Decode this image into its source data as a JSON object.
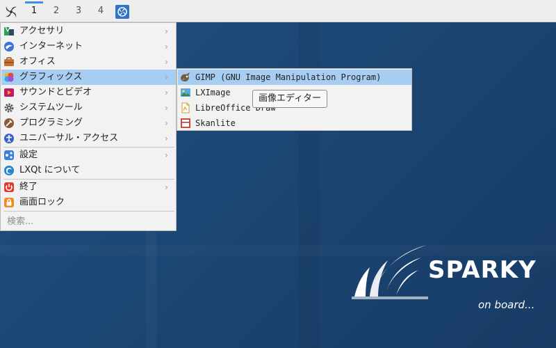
{
  "panel": {
    "desktops": [
      "1",
      "2",
      "3",
      "4"
    ],
    "active_desktop": "1"
  },
  "main_menu": {
    "items": [
      {
        "label": "アクセサリ",
        "icon": "accessories-icon",
        "submenu": true
      },
      {
        "label": "インターネット",
        "icon": "internet-icon",
        "submenu": true
      },
      {
        "label": "オフィス",
        "icon": "office-icon",
        "submenu": true
      },
      {
        "label": "グラフィックス",
        "icon": "graphics-icon",
        "submenu": true,
        "highlighted": true
      },
      {
        "label": "サウンドとビデオ",
        "icon": "multimedia-icon",
        "submenu": true
      },
      {
        "label": "システムツール",
        "icon": "system-tools-icon",
        "submenu": true
      },
      {
        "label": "プログラミング",
        "icon": "programming-icon",
        "submenu": true
      },
      {
        "label": "ユニバーサル・アクセス",
        "icon": "universal-access-icon",
        "submenu": true
      },
      {
        "label": "設定",
        "icon": "settings-icon",
        "submenu": true
      },
      {
        "label": "LXQt について",
        "icon": "lxqt-about-icon",
        "submenu": false
      },
      {
        "label": "終了",
        "icon": "power-icon",
        "submenu": true
      },
      {
        "label": "画面ロック",
        "icon": "lock-icon",
        "submenu": false
      }
    ],
    "arrow": "›",
    "search_placeholder": "検索..."
  },
  "graphics_submenu": {
    "items": [
      {
        "label": "GIMP (GNU Image Manipulation Program)",
        "icon": "gimp-icon",
        "highlighted": true
      },
      {
        "label": "LXImage",
        "icon": "image-viewer-icon"
      },
      {
        "label": "LibreOffice Draw",
        "icon": "libreoffice-draw-icon"
      },
      {
        "label": "Skanlite",
        "icon": "scanner-icon"
      }
    ]
  },
  "tooltip": {
    "text": "画像エディター"
  },
  "desktop_logo": {
    "word": "SPARKY",
    "tagline": "on board..."
  },
  "colors": {
    "highlight": "#a8cdf2",
    "desktop": "#1d4674",
    "active_indicator": "#3d8ee6"
  }
}
